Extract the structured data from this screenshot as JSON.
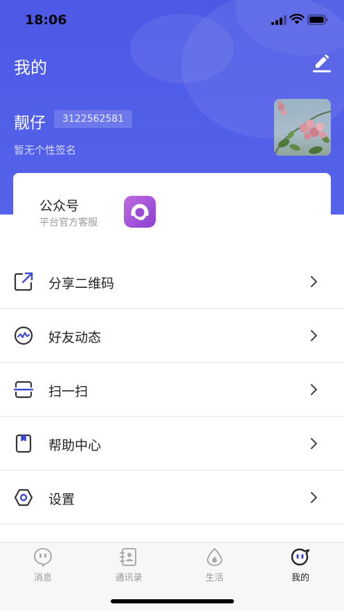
{
  "status_bar": {
    "time": "18:06"
  },
  "header": {
    "title": "我的"
  },
  "profile": {
    "name": "靓仔",
    "id": "3122562581",
    "signature": "暂无个性签名"
  },
  "official_account": {
    "title": "公众号",
    "subtitle": "平台官方客服"
  },
  "menu": {
    "items": [
      {
        "label": "分享二维码",
        "icon": "share-qrcode-icon"
      },
      {
        "label": "好友动态",
        "icon": "friends-activity-icon"
      },
      {
        "label": "扫一扫",
        "icon": "scan-icon"
      },
      {
        "label": "帮助中心",
        "icon": "help-center-icon"
      },
      {
        "label": "设置",
        "icon": "settings-icon"
      }
    ]
  },
  "tabbar": {
    "tabs": [
      {
        "label": "消息",
        "icon": "message-icon"
      },
      {
        "label": "通讯录",
        "icon": "contacts-icon"
      },
      {
        "label": "生活",
        "icon": "life-icon"
      },
      {
        "label": "我的",
        "icon": "profile-icon",
        "active": true
      }
    ]
  },
  "colors": {
    "accent": "#4d59e6",
    "icon_blue": "#3d4ad8"
  }
}
